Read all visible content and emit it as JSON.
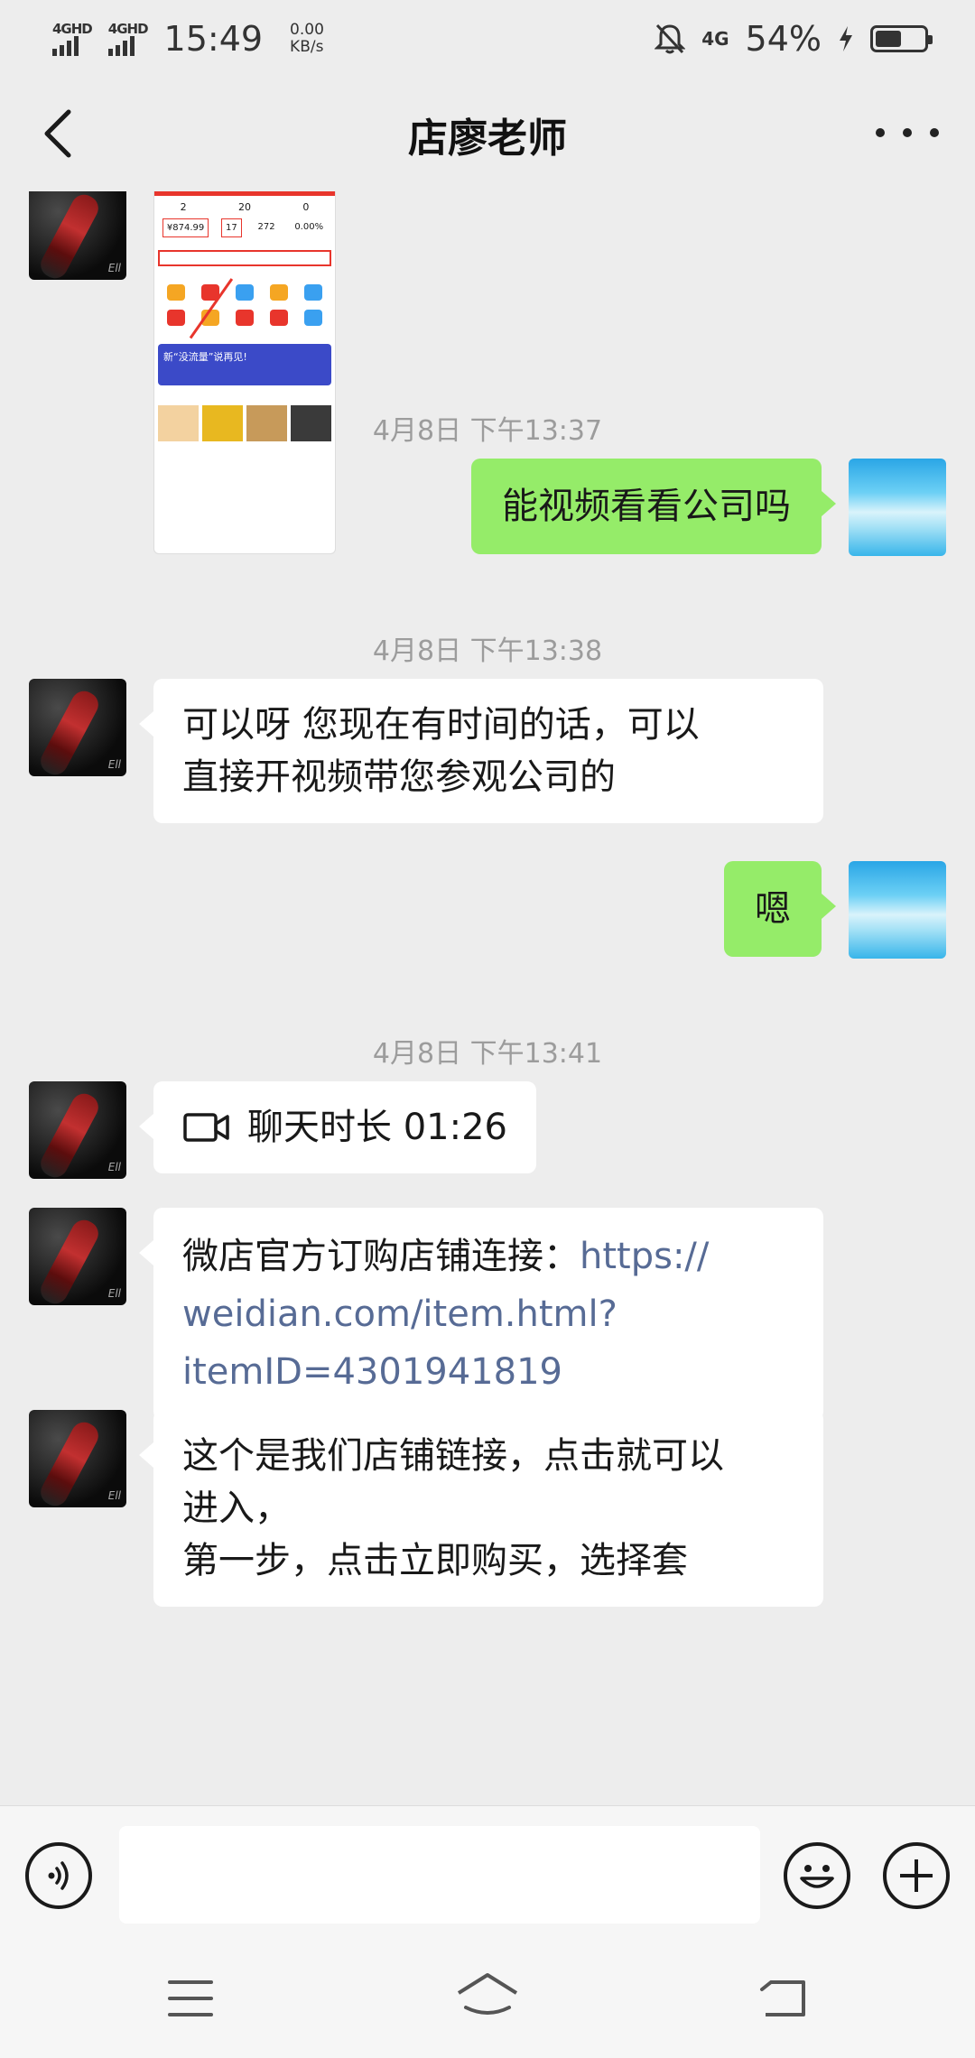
{
  "status_bar": {
    "signal1": "4GHD",
    "signal2": "4GHD",
    "time": "15:49",
    "net_speed_value": "0.00",
    "net_speed_unit": "KB/s",
    "network": "4G",
    "battery_percent": "54%",
    "battery_level": 0.54
  },
  "nav": {
    "title": "店廖老师"
  },
  "image_thumb": {
    "stats": [
      "2",
      "20",
      "0"
    ],
    "boxes": [
      "¥874.99",
      "17",
      "272",
      "0.00%"
    ],
    "banner_text": "新“没流量”说再见!"
  },
  "messages": {
    "ts1": "4月8日 下午13:37",
    "out1": "能视频看看公司吗",
    "ts2": "4月8日 下午13:38",
    "in1_line1": "可以呀 您现在有时间的话，可以",
    "in1_line2": "直接开视频带您参观公司的",
    "out2": "嗯",
    "ts3": "4月8日 下午13:41",
    "call_label": "聊天时长 01:26",
    "link_prefix": "微店官方订购店铺连接：",
    "link_url1": "https://",
    "link_url2": "weidian.com/item.html?",
    "link_url3": "itemID=4301941819",
    "in_last_line1": "这个是我们店铺链接，点击就可以",
    "in_last_line2": "进入，",
    "in_last_line3": "第一步，点击立即购买，选择套"
  },
  "input": {
    "placeholder": ""
  },
  "icons": {
    "back": "chevron-left-icon",
    "more": "more-dots-icon",
    "voice": "voice-icon",
    "emoji": "emoji-icon",
    "plus": "plus-icon",
    "video": "video-call-icon"
  }
}
